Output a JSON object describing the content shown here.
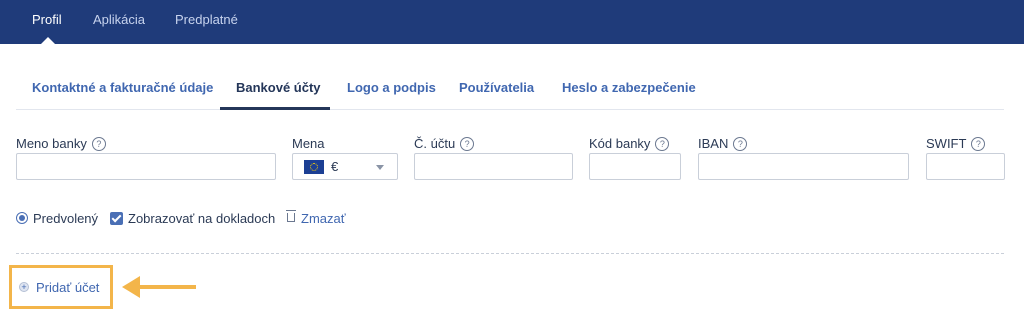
{
  "top_nav": {
    "profile": "Profil",
    "applications": "Aplikácia",
    "subscription": "Predplatné"
  },
  "sub_tabs": {
    "contact": "Kontaktné a fakturačné údaje",
    "bank_accounts": "Bankové účty",
    "logo": "Logo a podpis",
    "users": "Používatelia",
    "password": "Heslo a zabezpečenie"
  },
  "form": {
    "bank_name_label": "Meno banky",
    "currency_label": "Mena",
    "currency_value": "€",
    "account_number_label": "Č. účtu",
    "bank_code_label": "Kód banky",
    "iban_label": "IBAN",
    "swift_label": "SWIFT",
    "bank_name_value": "",
    "account_number_value": "",
    "bank_code_value": "",
    "iban_value": "",
    "swift_value": ""
  },
  "options": {
    "default_label": "Predvolený",
    "show_on_docs_label": "Zobrazovať na dokladoch",
    "delete_label": "Zmazať"
  },
  "add_account_label": "Pridať účet",
  "help_glyph": "?",
  "plus_glyph": "+",
  "colors": {
    "header": "#1f3b7a",
    "accent": "#4067b0",
    "highlight": "#f3b54a"
  }
}
